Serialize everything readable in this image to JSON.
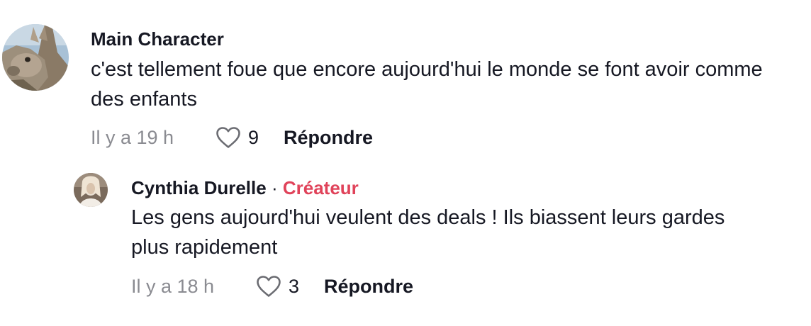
{
  "comments": [
    {
      "username": "Main Character",
      "text": "c'est tellement foue que encore aujourd'hui le monde se font avoir comme des enfants",
      "time": "Il y a 19 h",
      "likes": "9",
      "reply_label": "Répondre",
      "avatar_icon": "kangaroo-avatar"
    },
    {
      "username": "Cynthia Durelle",
      "separator": "·",
      "badge": "Créateur",
      "text": "Les gens aujourd'hui veulent des deals ! Ils biassent leurs gardes plus rapidement",
      "time": "Il y a 18 h",
      "likes": "3",
      "reply_label": "Répondre",
      "avatar_icon": "user-photo-avatar"
    }
  ],
  "colors": {
    "badge": "#e0435a",
    "muted": "#8a8b91",
    "text": "#161823"
  }
}
